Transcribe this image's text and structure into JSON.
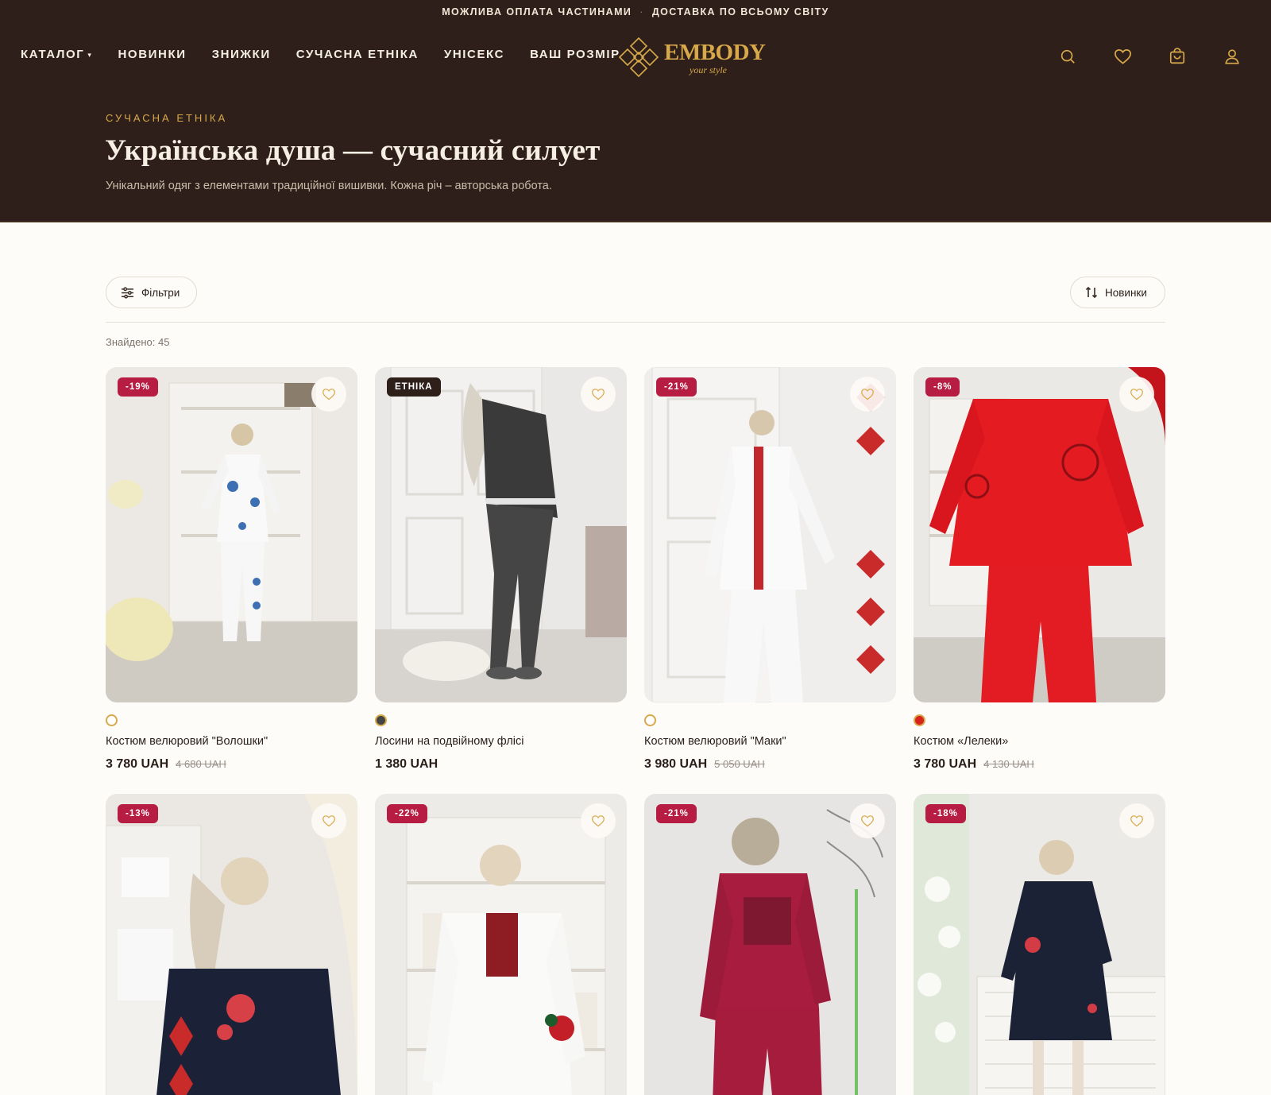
{
  "topbar": {
    "left": "МОЖЛИВА ОПЛАТА ЧАСТИНАМИ",
    "sep": "·",
    "right": "ДОСТАВКА ПО ВСЬОМУ СВІТУ"
  },
  "nav": {
    "catalog": "КАТАЛОГ",
    "caret": "▾",
    "items": [
      "НОВИНКИ",
      "ЗНИЖКИ",
      "СУЧАСНА ЕТНІКА",
      "УНІСЕКС",
      "ВАШ РОЗМІР"
    ]
  },
  "logo": {
    "word": "EMBODY",
    "tagline": "your style"
  },
  "header_icons": [
    "search-icon",
    "heart-icon",
    "cart-icon",
    "user-icon"
  ],
  "hero": {
    "eyebrow": "СУЧАСНА ЕТНІКА",
    "title": "Українська душа — сучасний силует",
    "subtitle": "Унікальний одяг з елементами традиційної вишивки. Кожна річ – авторська робота."
  },
  "toolbar": {
    "filters_label": "Фільтри",
    "sort_label": "Новинки",
    "found": "Знайдено: 45"
  },
  "colors": {
    "hero_bg": "#2e1f1a",
    "gold": "#d8a94a",
    "sale_badge": "#b71d43",
    "ethnic_badge": "#2e1f1a"
  },
  "products": [
    {
      "badge": "-19%",
      "badge_type": "sale",
      "swatch": "#ffffff",
      "name": "Костюм велюровий \"Волошки\"",
      "price": "3 780 UAH",
      "old_price": "4 680 UAH"
    },
    {
      "badge": "ЕТНІКА",
      "badge_type": "ethnic",
      "swatch": "#444444",
      "name": "Лосини на подвійному флісі",
      "price": "1 380 UAH",
      "old_price": ""
    },
    {
      "badge": "-21%",
      "badge_type": "sale",
      "swatch": "#ffffff",
      "name": "Костюм велюровий \"Маки\"",
      "price": "3 980 UAH",
      "old_price": "5 050 UAH"
    },
    {
      "badge": "-8%",
      "badge_type": "sale",
      "swatch": "#d8231b",
      "name": "Костюм «Лелеки»",
      "price": "3 780 UAH",
      "old_price": "4 130 UAH"
    },
    {
      "badge": "-13%",
      "badge_type": "sale"
    },
    {
      "badge": "-22%",
      "badge_type": "sale"
    },
    {
      "badge": "-21%",
      "badge_type": "sale"
    },
    {
      "badge": "-18%",
      "badge_type": "sale"
    }
  ]
}
